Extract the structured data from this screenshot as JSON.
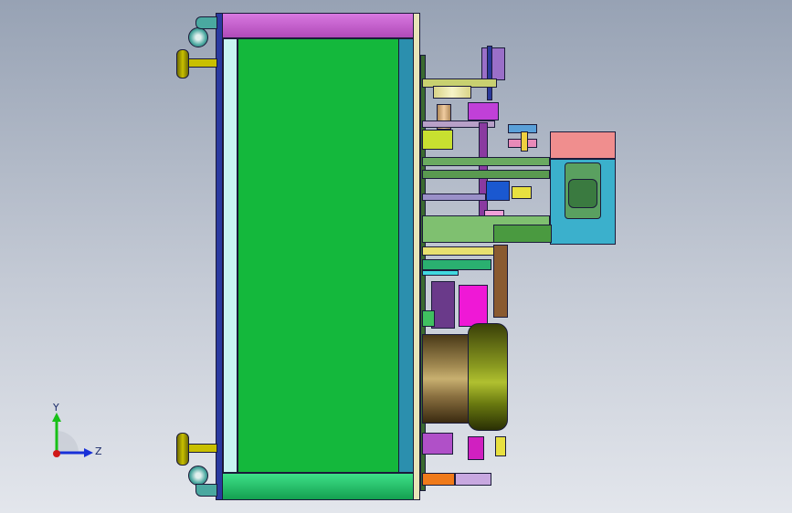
{
  "triad": {
    "y_label": "Y",
    "z_label": "Z"
  },
  "colors": {
    "background_top": "#97a2b4",
    "background_bottom": "#e3e6ec",
    "frame_top": "#c55ad0",
    "frame_bottom": "#1fca6a",
    "main_panel": "#14b83c",
    "side_panel": "#bdf2ee",
    "steel_blue": "#2b8fae",
    "motor_drum": "#7a6a3a",
    "motor_ring": "#5f6b10",
    "gearbox": "#f08e8e",
    "gearbox_body": "#3bb0cc",
    "magenta_block": "#ef18d6",
    "caster": "#4aa8a0",
    "leveling_foot": "#c9c000",
    "axis_x": "#d01818",
    "axis_y": "#18c018",
    "axis_z": "#1830d8"
  }
}
